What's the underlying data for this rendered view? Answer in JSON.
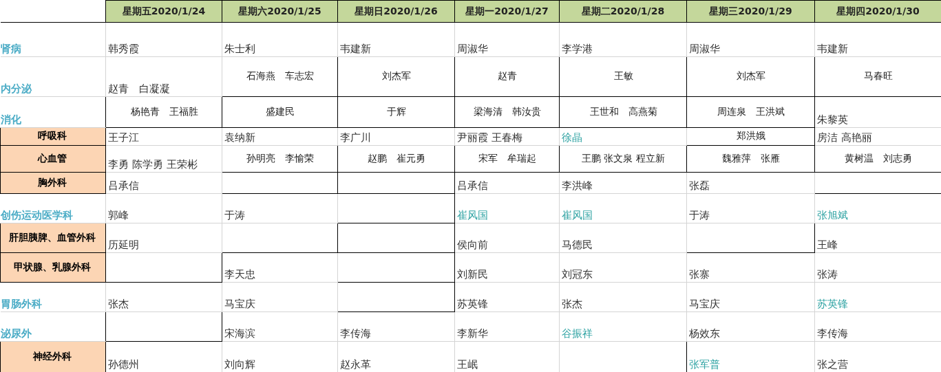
{
  "columns": [
    "星期五2020/1/24",
    "星期六2020/1/25",
    "星期日2020/1/26",
    "星期一2020/1/27",
    "星期二2020/1/28",
    "星期三2020/1/29",
    "星期四2020/1/30"
  ],
  "rows": [
    {
      "department": "肾病",
      "kind": "plain",
      "cells": [
        {
          "text": "韩秀霞",
          "kind": "plain",
          "marked": false
        },
        {
          "text": "朱士利",
          "kind": "plain",
          "marked": false
        },
        {
          "text": "韦建新",
          "kind": "plain",
          "marked": false
        },
        {
          "text": "周淑华",
          "kind": "plain",
          "marked": false
        },
        {
          "text": "李学港",
          "kind": "plain",
          "marked": false
        },
        {
          "text": "周淑华",
          "kind": "plain",
          "marked": false
        },
        {
          "text": "韦建新",
          "kind": "plain",
          "marked": false
        }
      ]
    },
    {
      "department": "内分泌",
      "kind": "plain",
      "cells": [
        {
          "text": "赵青　白凝凝",
          "kind": "plain",
          "marked": false
        },
        {
          "text": "石海燕　车志宏",
          "kind": "boxed",
          "marked": false
        },
        {
          "text": "刘杰军",
          "kind": "boxed",
          "marked": false
        },
        {
          "text": "赵青",
          "kind": "boxed",
          "marked": false
        },
        {
          "text": "王敏",
          "kind": "boxed",
          "marked": false
        },
        {
          "text": "刘杰军",
          "kind": "boxed",
          "marked": false
        },
        {
          "text": "马春旺",
          "kind": "boxed",
          "marked": false
        }
      ]
    },
    {
      "department": "消化",
      "kind": "plain",
      "cells": [
        {
          "text": "杨艳青　王福胜",
          "kind": "boxed",
          "marked": false
        },
        {
          "text": "盛建民",
          "kind": "boxed",
          "marked": false
        },
        {
          "text": "于辉",
          "kind": "boxed",
          "marked": false
        },
        {
          "text": "梁海清　韩汝贵",
          "kind": "boxed",
          "marked": false
        },
        {
          "text": "王世和　高燕菊",
          "kind": "boxed",
          "marked": false
        },
        {
          "text": "周连泉　王洪斌",
          "kind": "boxed",
          "marked": false
        },
        {
          "text": "朱黎英",
          "kind": "plain",
          "marked": false
        }
      ]
    },
    {
      "department": "呼吸科",
      "kind": "filled",
      "cells": [
        {
          "text": "王子江",
          "kind": "plain",
          "marked": false
        },
        {
          "text": "袁纳新",
          "kind": "plain",
          "marked": false
        },
        {
          "text": "李广川",
          "kind": "plain",
          "marked": false
        },
        {
          "text": "尹丽霞 王春梅",
          "kind": "plain",
          "marked": false
        },
        {
          "text": "徐晶",
          "kind": "plain",
          "marked": true
        },
        {
          "text": "郑洪娥",
          "kind": "boxed",
          "marked": false
        },
        {
          "text": "房洁  高艳丽",
          "kind": "plain",
          "marked": false
        }
      ]
    },
    {
      "department": "心血管",
      "kind": "filled",
      "cells": [
        {
          "text": "李勇  陈学勇 王荣彬",
          "kind": "plain",
          "marked": false
        },
        {
          "text": "孙明亮　李愉荣",
          "kind": "boxed",
          "marked": false
        },
        {
          "text": "赵鹏　崔元勇",
          "kind": "boxed",
          "marked": false
        },
        {
          "text": "宋军　牟瑞起",
          "kind": "boxed",
          "marked": false
        },
        {
          "text": "王鹏  张文泉  程立新",
          "kind": "boxed",
          "marked": false
        },
        {
          "text": "魏雅萍　张雁",
          "kind": "boxed",
          "marked": false
        },
        {
          "text": "黄树温　刘志勇",
          "kind": "boxed",
          "marked": false
        }
      ]
    },
    {
      "department": "胸外科",
      "kind": "filled",
      "cells": [
        {
          "text": "吕承信",
          "kind": "plain",
          "marked": false
        },
        {
          "kind": "boxed"
        },
        {
          "kind": "boxed"
        },
        {
          "text": "吕承信",
          "kind": "plain",
          "marked": false
        },
        {
          "text": "李洪峰",
          "kind": "plain",
          "marked": false
        },
        {
          "text": "张磊",
          "kind": "plain",
          "marked": false
        },
        {
          "kind": "boxed"
        }
      ]
    },
    {
      "department": "创伤运动医学科",
      "kind": "plain",
      "cells": [
        {
          "text": "郭峰",
          "kind": "plain",
          "marked": false
        },
        {
          "text": "于涛",
          "kind": "plain",
          "marked": false
        },
        {
          "kind": "boxed"
        },
        {
          "text": "崔风国",
          "kind": "plain",
          "marked": true
        },
        {
          "text": "崔风国",
          "kind": "plain",
          "marked": true
        },
        {
          "text": "于涛",
          "kind": "plain",
          "marked": false
        },
        {
          "text": "张旭斌",
          "kind": "plain",
          "marked": true
        }
      ]
    },
    {
      "department": "肝胆胰脾、血管外科",
      "kind": "filled",
      "cells": [
        {
          "text": "历延明",
          "kind": "plain",
          "marked": false
        },
        {
          "kind": "boxed"
        },
        {
          "kind": "boxed"
        },
        {
          "text": "侯向前",
          "kind": "plain",
          "marked": false
        },
        {
          "text": "马德民",
          "kind": "plain",
          "marked": false
        },
        {
          "kind": "boxed"
        },
        {
          "text": "王峰",
          "kind": "plain",
          "marked": false
        }
      ]
    },
    {
      "department": "甲状腺、乳腺外科",
      "kind": "filled",
      "cells": [
        {
          "kind": "boxed"
        },
        {
          "text": "李天忠",
          "kind": "plain",
          "marked": false
        },
        {
          "kind": "boxed"
        },
        {
          "text": "刘新民",
          "kind": "plain",
          "marked": false
        },
        {
          "text": "刘冠东",
          "kind": "plain",
          "marked": false
        },
        {
          "text": "张寨",
          "kind": "plain",
          "marked": false
        },
        {
          "text": "张涛",
          "kind": "plain",
          "marked": false
        }
      ]
    },
    {
      "department": "胃肠外科",
      "kind": "plain",
      "cells": [
        {
          "text": "张杰",
          "kind": "plain",
          "marked": false
        },
        {
          "text": "马宝庆",
          "kind": "plain",
          "marked": false
        },
        {
          "kind": "boxed"
        },
        {
          "text": "苏英锋",
          "kind": "plain",
          "marked": false
        },
        {
          "text": "张杰",
          "kind": "plain",
          "marked": false
        },
        {
          "text": "马宝庆",
          "kind": "plain",
          "marked": false
        },
        {
          "text": "苏英锋",
          "kind": "plain",
          "marked": true
        }
      ]
    },
    {
      "department": "泌尿外",
      "kind": "plain",
      "cells": [
        {
          "kind": "boxed"
        },
        {
          "text": "宋海滨",
          "kind": "plain",
          "marked": false
        },
        {
          "text": "李传海",
          "kind": "plain",
          "marked": false
        },
        {
          "text": "李新华",
          "kind": "plain",
          "marked": false
        },
        {
          "text": "谷振祥",
          "kind": "plain",
          "marked": true
        },
        {
          "text": "杨效东",
          "kind": "plain",
          "marked": false
        },
        {
          "text": "李传海",
          "kind": "plain",
          "marked": false
        }
      ]
    },
    {
      "department": "神经外科",
      "kind": "filled",
      "cells": [
        {
          "text": "孙德州",
          "kind": "plain",
          "marked": false
        },
        {
          "text": "刘向辉",
          "kind": "plain",
          "marked": false
        },
        {
          "text": "赵永革",
          "kind": "plain",
          "marked": false
        },
        {
          "text": "王岷",
          "kind": "plain",
          "marked": false
        },
        {
          "kind": "boxed"
        },
        {
          "text": "张军普",
          "kind": "plain",
          "marked": true
        },
        {
          "text": "张之营",
          "kind": "plain",
          "marked": false
        }
      ]
    }
  ]
}
